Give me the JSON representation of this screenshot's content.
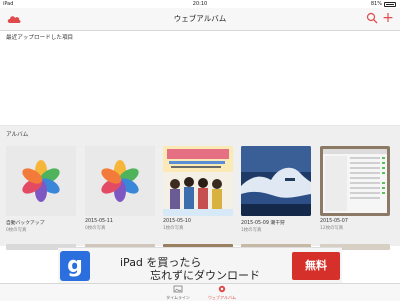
{
  "status_bar": {
    "device": "iPad",
    "time": "20:10",
    "battery": "81%",
    "battery_level": 0.81
  },
  "navbar": {
    "title": "ウェブアルバム"
  },
  "recent": {
    "label": "最近アップロードした項目"
  },
  "albums": {
    "label": "アルバム",
    "items": [
      {
        "name": "自動バックアップ",
        "count": "0枚の写真",
        "thumb": "flower-icon"
      },
      {
        "name": "2015-05-11",
        "count": "0枚の写真",
        "thumb": "flower-icon"
      },
      {
        "name": "2015-05-10",
        "count": "1枚の写真",
        "thumb": "poster"
      },
      {
        "name": "2015-05-09 潮干狩",
        "count": "1枚の写真",
        "thumb": "wave"
      },
      {
        "name": "2015-05-07",
        "count": "12枚の写真",
        "thumb": "screenshot"
      }
    ]
  },
  "ad": {
    "logo": "g",
    "line1": "iPad を買ったら",
    "line2": "忘れずにダウンロード",
    "cta": "無料"
  },
  "tabbar": {
    "tabs": [
      {
        "label": "タイムライン",
        "active": false
      },
      {
        "label": "ウェブアルバム",
        "active": true
      }
    ]
  },
  "colors": {
    "accent": "#e14a4a",
    "ad_blue": "#2a6fdd",
    "ad_cta": "#d6302a"
  }
}
